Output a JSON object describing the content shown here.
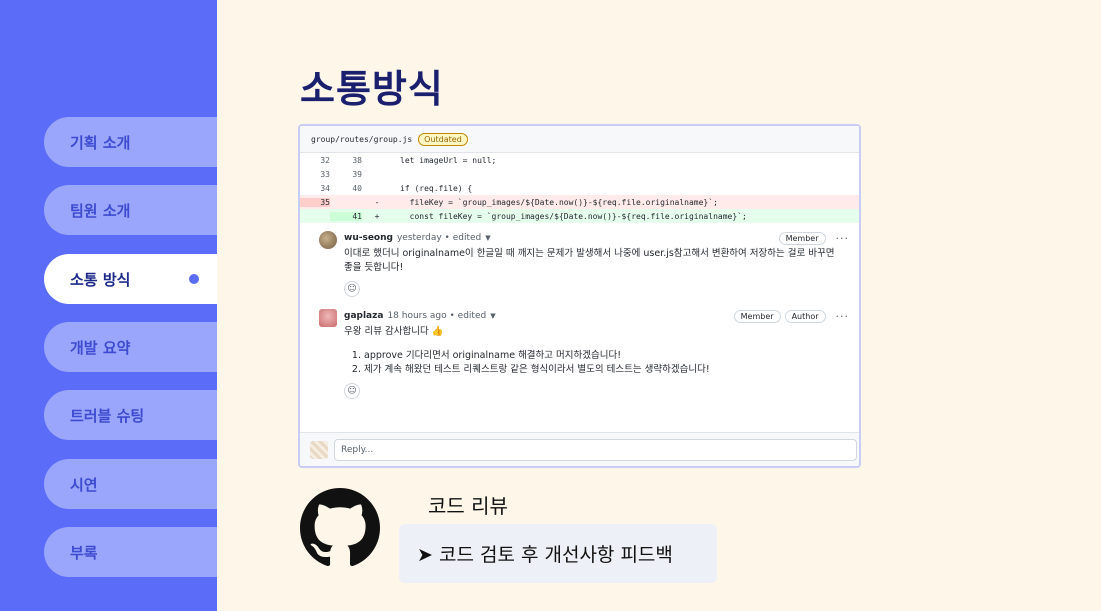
{
  "sidebar": {
    "items": [
      {
        "label": "기획 소개",
        "active": false
      },
      {
        "label": "팀원 소개",
        "active": false
      },
      {
        "label": "소통 방식",
        "active": true
      },
      {
        "label": "개발 요약",
        "active": false
      },
      {
        "label": "트러블 슈팅",
        "active": false
      },
      {
        "label": "시연",
        "active": false
      },
      {
        "label": "부록",
        "active": false
      }
    ]
  },
  "title": "소통방식",
  "review": {
    "file_path": "group/routes/group.js",
    "outdated_label": "Outdated",
    "code_lines": [
      {
        "old": "32",
        "new": "38",
        "sign": "",
        "code": "let imageUrl = null;"
      },
      {
        "old": "33",
        "new": "39",
        "sign": "",
        "code": ""
      },
      {
        "old": "34",
        "new": "40",
        "sign": "",
        "code": "if (req.file) {"
      },
      {
        "old": "35",
        "new": "",
        "sign": "-",
        "code": "  fileKey = `group_images/${Date.now()}-${req.file.originalname}`;"
      },
      {
        "old": "",
        "new": "41",
        "sign": "+",
        "code": "  const fileKey = `group_images/${Date.now()}-${req.file.originalname}`;"
      }
    ],
    "comments": [
      {
        "author": "wu-seong",
        "meta": "yesterday • edited",
        "badges": [
          "Member"
        ],
        "body": "이대로 했더니 originalname이 한글일 때 깨지는 문제가 발생해서 나중에 user.js참고해서 변환하여 저장하는 걸로 바꾸면 좋을 듯합니다!"
      },
      {
        "author": "gaplaza",
        "meta": "18 hours ago • edited",
        "badges": [
          "Member",
          "Author"
        ],
        "body": "우왕 리뷰 감사합니다 👍",
        "list": [
          "approve 기다리면서 originalname 해결하고 머지하겠습니다!",
          "제가 계속 해왔던 테스트 리퀘스트랑 같은 형식이라서 별도의 테스트는 생략하겠습니다!"
        ]
      }
    ],
    "reply_placeholder": "Reply..."
  },
  "code_review_label": "코드 리뷰",
  "feedback_text": "➤ 코드 검토 후 개선사항 피드백",
  "colors": {
    "sidebar": "#5b6cf9",
    "background": "#fdf6e9",
    "title": "#1a1f6e"
  }
}
